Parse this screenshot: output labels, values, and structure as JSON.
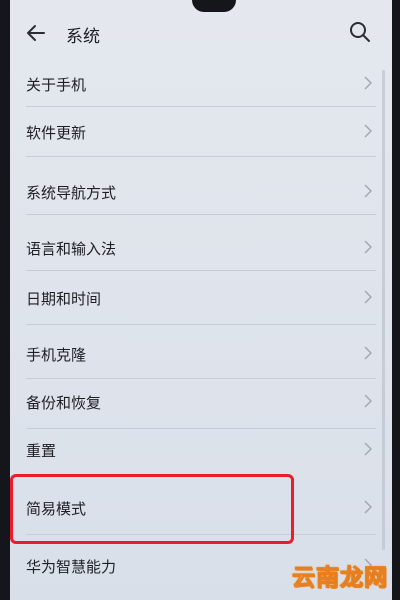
{
  "header": {
    "title": "系统",
    "back_icon": "back-arrow-icon",
    "search_icon": "search-icon"
  },
  "settings_items": [
    {
      "label": "关于手机"
    },
    {
      "label": "软件更新"
    },
    {
      "label": "系统导航方式"
    },
    {
      "label": "语言和输入法"
    },
    {
      "label": "日期和时间"
    },
    {
      "label": "手机克隆"
    },
    {
      "label": "备份和恢复"
    },
    {
      "label": "重置"
    },
    {
      "label": "简易模式"
    },
    {
      "label": "华为智慧能力"
    }
  ],
  "annotation": {
    "highlighted_item": "简易模式",
    "color": "#ee1c2a"
  },
  "watermark": {
    "text": "云南龙网"
  }
}
